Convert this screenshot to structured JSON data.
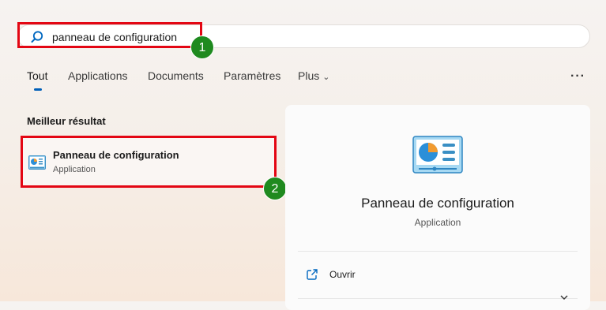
{
  "search": {
    "query": "panneau de configuration"
  },
  "tabs": [
    {
      "label": "Tout",
      "active": true
    },
    {
      "label": "Applications"
    },
    {
      "label": "Documents"
    },
    {
      "label": "Paramètres"
    },
    {
      "label": "Plus"
    }
  ],
  "more_icon": "more-dots-icon",
  "best_match": {
    "heading": "Meilleur résultat",
    "title": "Panneau de configuration",
    "subtitle": "Application",
    "icon": "control-panel-icon"
  },
  "details": {
    "title": "Panneau de configuration",
    "subtitle": "Application",
    "icon": "control-panel-icon",
    "actions": [
      {
        "label": "Ouvrir",
        "icon": "open-external-icon"
      }
    ],
    "expand_icon": "chevron-down-icon"
  },
  "annotations": {
    "badge_1": "1",
    "badge_2": "2",
    "highlight_color": "#e30613",
    "badge_color": "#1f8a1f"
  },
  "colors": {
    "accent": "#005fb8"
  }
}
